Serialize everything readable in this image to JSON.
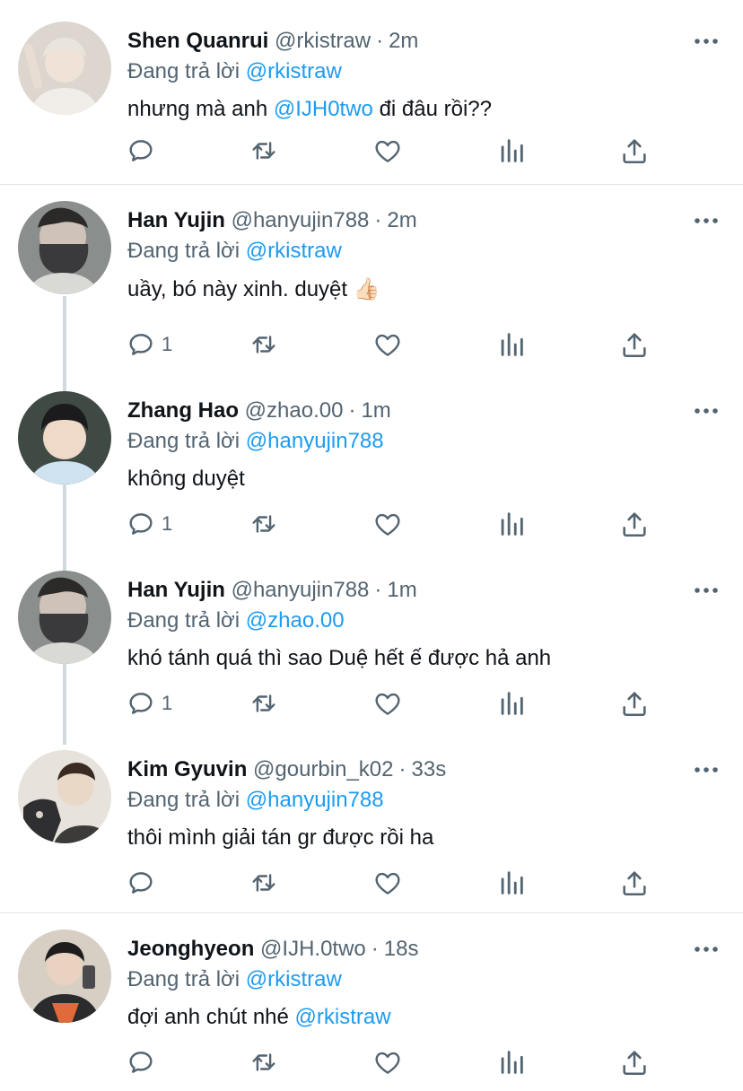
{
  "reply_prefix": "Đang trả lời",
  "colors": {
    "link": "#1d9bf0",
    "muted": "#536471",
    "text": "#0f1419"
  },
  "tweets": [
    {
      "name": "Shen Quanrui",
      "handle": "@rkistraw",
      "time": "2m",
      "reply_to": "@rkistraw",
      "body_before": "nhưng mà anh ",
      "body_mention": "@IJH0two",
      "body_after": " đi đâu rồi??",
      "reply_count": ""
    },
    {
      "name": "Han Yujin",
      "handle": "@hanyujin788",
      "time": "2m",
      "reply_to": "@rkistraw",
      "body_before": "uầy, bó này xinh. duyệt 👍🏻",
      "body_mention": "",
      "body_after": "",
      "reply_count": "1"
    },
    {
      "name": "Zhang Hao",
      "handle": "@zhao.00",
      "time": "1m",
      "reply_to": "@hanyujin788",
      "body_before": "không duyệt",
      "body_mention": "",
      "body_after": "",
      "reply_count": "1"
    },
    {
      "name": "Han Yujin",
      "handle": "@hanyujin788",
      "time": "1m",
      "reply_to": "@zhao.00",
      "body_before": "khó tánh quá thì sao Duệ hết ế được hả anh",
      "body_mention": "",
      "body_after": "",
      "reply_count": "1"
    },
    {
      "name": "Kim Gyuvin",
      "handle": "@gourbin_k02",
      "time": "33s",
      "reply_to": "@hanyujin788",
      "body_before": "thôi mình giải tán gr được rồi ha",
      "body_mention": "",
      "body_after": "",
      "reply_count": ""
    },
    {
      "name": "Jeonghyeon",
      "handle": "@IJH.0two",
      "time": "18s",
      "reply_to": "@rkistraw",
      "body_before": "đợi anh chút nhé ",
      "body_mention": "@rkistraw",
      "body_after": "",
      "reply_count": ""
    }
  ],
  "icons": {
    "avatar": "avatar-photo",
    "more": "more-options-icon",
    "reply": "reply-icon",
    "retweet": "retweet-icon",
    "like": "heart-icon",
    "views": "analytics-icon",
    "share": "share-icon"
  }
}
